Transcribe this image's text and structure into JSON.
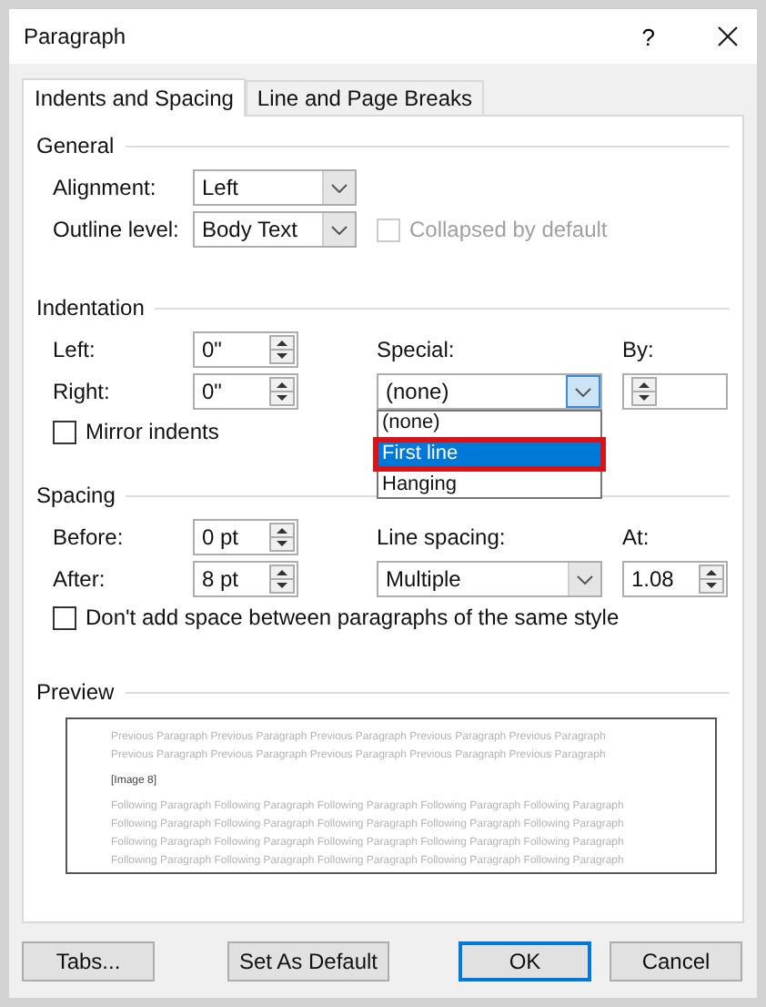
{
  "window": {
    "title": "Paragraph",
    "help": "?"
  },
  "tabs": [
    {
      "label": "Indents and Spacing",
      "selected": true
    },
    {
      "label": "Line and Page Breaks",
      "selected": false
    }
  ],
  "general": {
    "title": "General",
    "alignment": {
      "label": "Alignment:",
      "value": "Left"
    },
    "outline_level": {
      "label": "Outline level:",
      "value": "Body Text"
    },
    "collapsed": {
      "label": "Collapsed by default",
      "checked": false,
      "disabled": true
    }
  },
  "indentation": {
    "title": "Indentation",
    "left": {
      "label": "Left:",
      "value": "0\""
    },
    "right": {
      "label": "Right:",
      "value": "0\""
    },
    "special": {
      "label": "Special:",
      "value": "(none)",
      "open": true,
      "options": [
        {
          "label": "(none)",
          "highlighted": false,
          "outlined": false
        },
        {
          "label": "First line",
          "highlighted": true,
          "outlined": true
        },
        {
          "label": "Hanging",
          "highlighted": false,
          "outlined": false
        }
      ]
    },
    "by": {
      "label": "By:"
    },
    "mirror": {
      "label": "Mirror indents",
      "checked": false,
      "disabled": false
    }
  },
  "spacing": {
    "title": "Spacing",
    "before": {
      "label": "Before:",
      "value": "0 pt"
    },
    "after": {
      "label": "After:",
      "value": "8 pt"
    },
    "line_spacing": {
      "label": "Line spacing:",
      "value": "Multiple",
      "open": false
    },
    "at": {
      "label": "At:",
      "value": "1.08"
    },
    "dont_add": {
      "label": "Don't add space between paragraphs of the same style",
      "checked": false,
      "disabled": false
    }
  },
  "preview": {
    "title": "Preview",
    "previous": [
      "Previous Paragraph Previous Paragraph Previous Paragraph Previous Paragraph Previous Paragraph",
      "Previous Paragraph Previous Paragraph Previous Paragraph Previous Paragraph Previous Paragraph"
    ],
    "current": "[Image 8]",
    "following": [
      "Following Paragraph Following Paragraph Following Paragraph Following Paragraph Following Paragraph",
      "Following Paragraph Following Paragraph Following Paragraph Following Paragraph Following Paragraph",
      "Following Paragraph Following Paragraph Following Paragraph Following Paragraph Following Paragraph",
      "Following Paragraph Following Paragraph Following Paragraph Following Paragraph Following Paragraph"
    ]
  },
  "buttons": [
    {
      "label": "Tabs...",
      "default": false
    },
    {
      "label": "Set As Default",
      "default": false
    },
    {
      "label": "OK",
      "default": true
    },
    {
      "label": "Cancel",
      "default": false
    }
  ]
}
